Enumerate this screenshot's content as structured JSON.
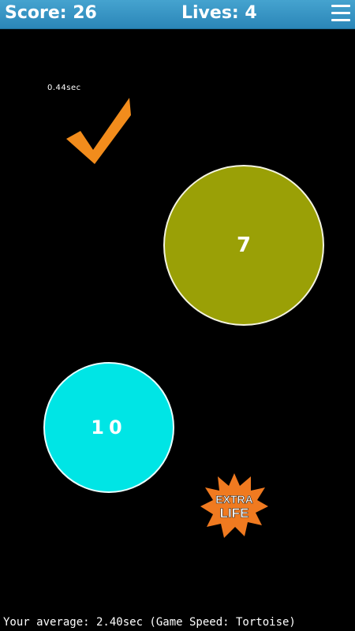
{
  "header": {
    "score_label": "Score: 26",
    "lives_label": "Lives: 4",
    "menu_icon": "hamburger-menu-icon"
  },
  "feedback": {
    "reaction_time": "0.44sec",
    "icon": "checkmark-icon",
    "color": "#f28c1c"
  },
  "circles": [
    {
      "number": "7",
      "color": "#9aa006"
    },
    {
      "number": "10",
      "color": "#00e5e5"
    }
  ],
  "powerup": {
    "line1": "EXTRA",
    "line2": "LIFE",
    "color": "#f07a20"
  },
  "footer": {
    "average_text": "Your average: 2.40sec (Game Speed: Tortoise)"
  }
}
